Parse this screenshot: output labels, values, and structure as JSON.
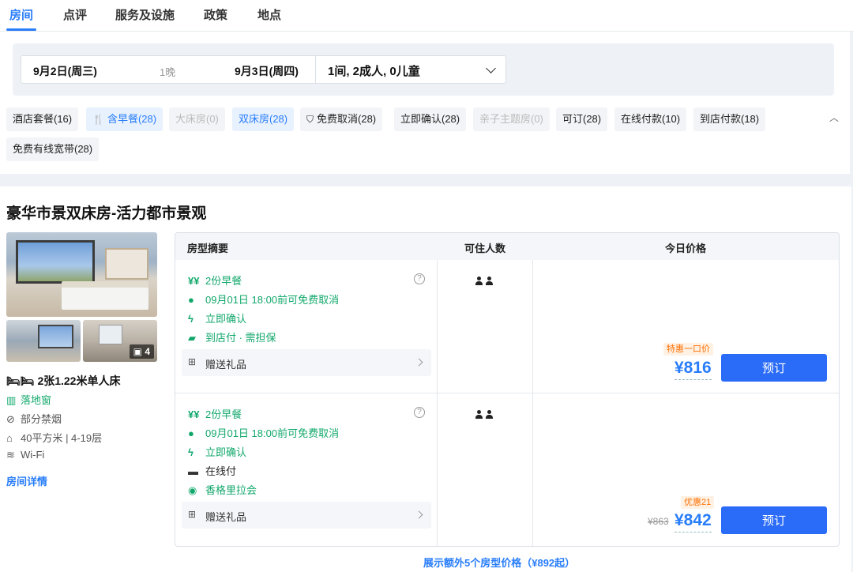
{
  "tabs": [
    {
      "label": "房间"
    },
    {
      "label": "点评"
    },
    {
      "label": "服务及设施"
    },
    {
      "label": "政策"
    },
    {
      "label": "地点"
    }
  ],
  "search": {
    "checkin": "9月2日(周三)",
    "nights": "1晚",
    "checkout": "9月3日(周四)",
    "guests": "1间, 2成人, 0儿童"
  },
  "filters": [
    {
      "label": "酒店套餐(16)"
    },
    {
      "label": "含早餐(28)"
    },
    {
      "label": "大床房(0)"
    },
    {
      "label": "双床房(28)"
    },
    {
      "label": "免费取消(28)"
    },
    {
      "label": "立即确认(28)"
    },
    {
      "label": "亲子主题房(0)"
    },
    {
      "label": "可订(28)"
    },
    {
      "label": "在线付款(10)"
    },
    {
      "label": "到店付款(18)"
    },
    {
      "label": "免费有线宽带(28)"
    }
  ],
  "collapse_icon": "chevron-up-icon",
  "room": {
    "title": "豪华市景双床房-活力都市景观",
    "photo_count": "4",
    "bed": "2张1.22米单人床",
    "features": [
      {
        "label": "落地窗",
        "icon": "window-icon"
      },
      {
        "label": "部分禁烟",
        "icon": "no-smoking-icon"
      },
      {
        "label": "40平方米 | 4-19层",
        "icon": "area-icon"
      },
      {
        "label": "Wi-Fi",
        "icon": "wifi-icon"
      }
    ],
    "detail_link": "房间详情"
  },
  "table": {
    "col_summary": "房型摘要",
    "col_occupancy": "可住人数",
    "col_price": "今日价格"
  },
  "rates": [
    {
      "lines": [
        {
          "label": "2份早餐",
          "icon": "breakfast-icon"
        },
        {
          "label": "09月01日 18:00前可免费取消",
          "icon": "check-circle-icon"
        },
        {
          "label": "立即确认",
          "icon": "lightning-icon"
        },
        {
          "label": "到店付 · 需担保",
          "icon": "pay-at-hotel-icon"
        }
      ],
      "gift": "赠送礼品",
      "badge": "特惠一口价",
      "old_price": "",
      "price": "¥816",
      "book_label": "预订"
    },
    {
      "lines": [
        {
          "label": "2份早餐",
          "icon": "breakfast-icon"
        },
        {
          "label": "09月01日 18:00前可免费取消",
          "icon": "check-circle-icon"
        },
        {
          "label": "立即确认",
          "icon": "lightning-icon"
        },
        {
          "label": "在线付",
          "icon": "card-icon"
        },
        {
          "label": "香格里拉会",
          "icon": "member-icon"
        }
      ],
      "gift": "赠送礼品",
      "badge": "优惠21",
      "old_price": "¥863",
      "price": "¥842",
      "book_label": "预订"
    }
  ],
  "more_link": "展示额外5个房型价格（¥892起）"
}
